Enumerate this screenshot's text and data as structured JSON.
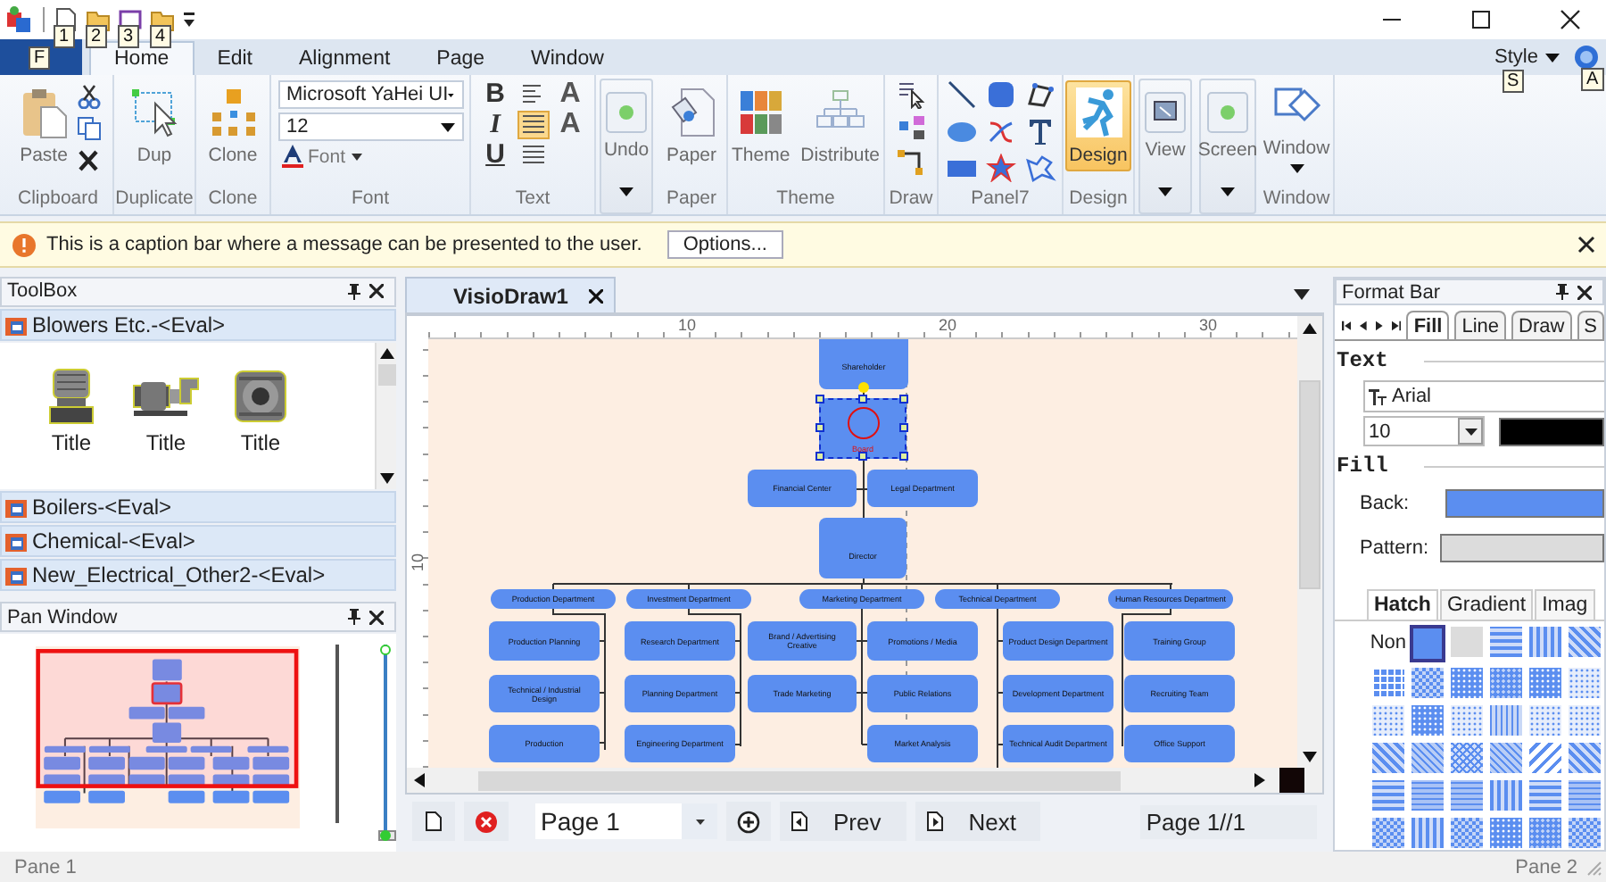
{
  "app": {
    "keytip": "F"
  },
  "quick_access": [
    {
      "keytip": "1"
    },
    {
      "keytip": "2"
    },
    {
      "keytip": "3"
    },
    {
      "keytip": "4"
    }
  ],
  "tabs": [
    {
      "label": "Home",
      "selected": true
    },
    {
      "label": "Edit",
      "selected": false
    },
    {
      "label": "Alignment",
      "selected": false
    },
    {
      "label": "Page",
      "selected": false
    },
    {
      "label": "Window",
      "selected": false
    }
  ],
  "style_menu": {
    "label": "Style",
    "keytip": "S"
  },
  "help": {
    "keytip": "A"
  },
  "ribbon": {
    "clipboard": {
      "label": "Clipboard",
      "paste": {
        "label": "Paste",
        "on": false
      }
    },
    "duplicate": {
      "label": "Duplicate",
      "dup": {
        "label": "Dup",
        "on": false
      }
    },
    "clone": {
      "label": "Clone",
      "clone": {
        "label": "Clone",
        "on": false
      }
    },
    "font": {
      "label": "Font",
      "family": "Microsoft YaHei UI",
      "size": "12",
      "color_button": "Font"
    },
    "text": {
      "label": "Text",
      "styles": [
        "B",
        "I",
        "U"
      ],
      "align": [
        {
          "selected": false
        },
        {
          "selected": true
        },
        {
          "selected": false
        }
      ],
      "resize": [
        "A",
        "A"
      ]
    },
    "undo": {
      "undo": {
        "label": "Undo",
        "on": false
      }
    },
    "paper": {
      "label": "Paper",
      "paper": {
        "label": "Paper",
        "on": false
      }
    },
    "theme": {
      "label": "Theme",
      "theme": {
        "label": "Theme",
        "on": false
      },
      "distribute": {
        "label": "Distribute",
        "on": false
      }
    },
    "draw": {
      "label": "Draw"
    },
    "panel7": {
      "label": "Panel7"
    },
    "design": {
      "label": "Design",
      "design": {
        "label": "Design",
        "on": true
      }
    },
    "view": {
      "view": {
        "label": "View",
        "on": false
      }
    },
    "screen": {
      "screen": {
        "label": "Screen",
        "on": false
      }
    },
    "window": {
      "label": "Window",
      "window": {
        "label": "Window",
        "on": false
      }
    }
  },
  "caption_bar": {
    "message": "This is a caption bar where a message can be presented to the user.",
    "button": "Options..."
  },
  "toolbox": {
    "title": "ToolBox",
    "sections": [
      {
        "label": "Blowers Etc.-<Eval>",
        "expanded": true,
        "items": [
          "Title",
          "Title",
          "Title"
        ]
      },
      {
        "label": "Boilers-<Eval>",
        "expanded": false
      },
      {
        "label": "Chemical-<Eval>",
        "expanded": false
      },
      {
        "label": "New_Electrical_Other2-<Eval>",
        "expanded": false
      }
    ]
  },
  "pan_window": {
    "title": "Pan Window",
    "zoom": {
      "level": 0
    }
  },
  "document": {
    "tab": "VisioDraw1",
    "ruler_h": [
      "10",
      "20",
      "30"
    ],
    "ruler_v": [
      "10"
    ]
  },
  "org_chart": {
    "nodes": [
      {
        "label": "Shareholder",
        "kind": "box",
        "selected": false,
        "children": [
          {
            "label": "Board",
            "kind": "circle",
            "selected": true,
            "children": [
              {
                "label": "Financial Center",
                "kind": "box",
                "selected": false
              },
              {
                "label": "Legal Department",
                "kind": "box",
                "selected": false
              },
              {
                "label": "Director",
                "kind": "box",
                "selected": false,
                "children": [
                  {
                    "label": "Production Department",
                    "kind": "pill",
                    "selected": false,
                    "children": [
                      {
                        "label": "Production Planning",
                        "kind": "box",
                        "selected": false
                      },
                      {
                        "label": "Technical / Industrial Design",
                        "kind": "box",
                        "selected": false
                      },
                      {
                        "label": "Production",
                        "kind": "box",
                        "selected": false
                      }
                    ]
                  },
                  {
                    "label": "Investment Department",
                    "kind": "pill",
                    "selected": false,
                    "children": [
                      {
                        "label": "Research Department",
                        "kind": "box",
                        "selected": false
                      },
                      {
                        "label": "Planning Department",
                        "kind": "box",
                        "selected": false
                      },
                      {
                        "label": "Engineering Department",
                        "kind": "box",
                        "selected": false
                      }
                    ]
                  },
                  {
                    "label": "Marketing Department",
                    "kind": "pill",
                    "selected": false,
                    "children": [
                      {
                        "label": "Brand / Advertising Creative",
                        "kind": "box",
                        "selected": false
                      },
                      {
                        "label": "Trade Marketing",
                        "kind": "box",
                        "selected": false
                      },
                      {
                        "label": "Promotions / Media",
                        "kind": "box",
                        "selected": false
                      },
                      {
                        "label": "Public Relations",
                        "kind": "box",
                        "selected": false
                      },
                      {
                        "label": "Market Analysis",
                        "kind": "box",
                        "selected": false
                      }
                    ]
                  },
                  {
                    "label": "Technical Department",
                    "kind": "pill",
                    "selected": false,
                    "children": [
                      {
                        "label": "Product Design Department",
                        "kind": "box",
                        "selected": false
                      },
                      {
                        "label": "Development Department",
                        "kind": "box",
                        "selected": false
                      },
                      {
                        "label": "Technical Audit Department",
                        "kind": "box",
                        "selected": false
                      }
                    ]
                  },
                  {
                    "label": "Human Resources Department",
                    "kind": "pill",
                    "selected": false,
                    "children": [
                      {
                        "label": "Training Group",
                        "kind": "box",
                        "selected": false
                      },
                      {
                        "label": "Recruiting Team",
                        "kind": "box",
                        "selected": false
                      },
                      {
                        "label": "Office Support",
                        "kind": "box",
                        "selected": false
                      }
                    ]
                  }
                ]
              }
            ]
          }
        ]
      }
    ]
  },
  "page_bar": {
    "page": "Page 1",
    "prev": "Prev",
    "next": "Next",
    "readout": "Page 1//1"
  },
  "format_bar": {
    "title": "Format Bar",
    "tabs": [
      {
        "label": "Fill",
        "selected": true
      },
      {
        "label": "Line",
        "selected": false
      },
      {
        "label": "Draw",
        "selected": false
      },
      {
        "label": "S",
        "selected": false
      }
    ],
    "text_legend": "Text",
    "font": "Arial",
    "size": "10",
    "fill_legend": "Fill",
    "back_label": "Back:",
    "pattern_label": "Pattern:",
    "subtabs": [
      {
        "label": "Hatch",
        "selected": true
      },
      {
        "label": "Gradient",
        "selected": false
      },
      {
        "label": "Imag",
        "selected": false
      }
    ],
    "none_label": "Non",
    "swatches": [
      {
        "kind": "solid",
        "selected": true
      },
      {
        "kind": "grey",
        "selected": false
      },
      {
        "kind": "hlines",
        "selected": false
      },
      {
        "kind": "vlines",
        "selected": false
      },
      {
        "kind": "diag",
        "selected": false
      },
      {
        "kind": "grid",
        "selected": false
      },
      {
        "kind": "checker",
        "selected": false
      },
      {
        "kind": "dots",
        "selected": false
      },
      {
        "kind": "dense",
        "selected": false
      },
      {
        "kind": "dots",
        "selected": false
      },
      {
        "kind": "light",
        "selected": false
      },
      {
        "kind": "light",
        "selected": false
      },
      {
        "kind": "dots",
        "selected": false
      },
      {
        "kind": "light",
        "selected": false
      },
      {
        "kind": "vfine",
        "selected": false
      },
      {
        "kind": "light",
        "selected": false
      },
      {
        "kind": "light",
        "selected": false
      },
      {
        "kind": "diag",
        "selected": false
      },
      {
        "kind": "dfine",
        "selected": false
      },
      {
        "kind": "cross",
        "selected": false
      },
      {
        "kind": "dfine",
        "selected": false
      },
      {
        "kind": "bdiag",
        "selected": false
      },
      {
        "kind": "diag",
        "selected": false
      },
      {
        "kind": "hlines",
        "selected": false
      },
      {
        "kind": "hfine",
        "selected": false
      },
      {
        "kind": "hfine",
        "selected": false
      },
      {
        "kind": "vlines",
        "selected": false
      },
      {
        "kind": "hlines",
        "selected": false
      },
      {
        "kind": "hfine",
        "selected": false
      },
      {
        "kind": "checker",
        "selected": false
      },
      {
        "kind": "vlines",
        "selected": false
      },
      {
        "kind": "checker",
        "selected": false
      },
      {
        "kind": "dots",
        "selected": false
      },
      {
        "kind": "dense",
        "selected": false
      },
      {
        "kind": "checker",
        "selected": false
      }
    ]
  },
  "status_bar": {
    "left": "Pane 1",
    "right": "Pane 2"
  }
}
